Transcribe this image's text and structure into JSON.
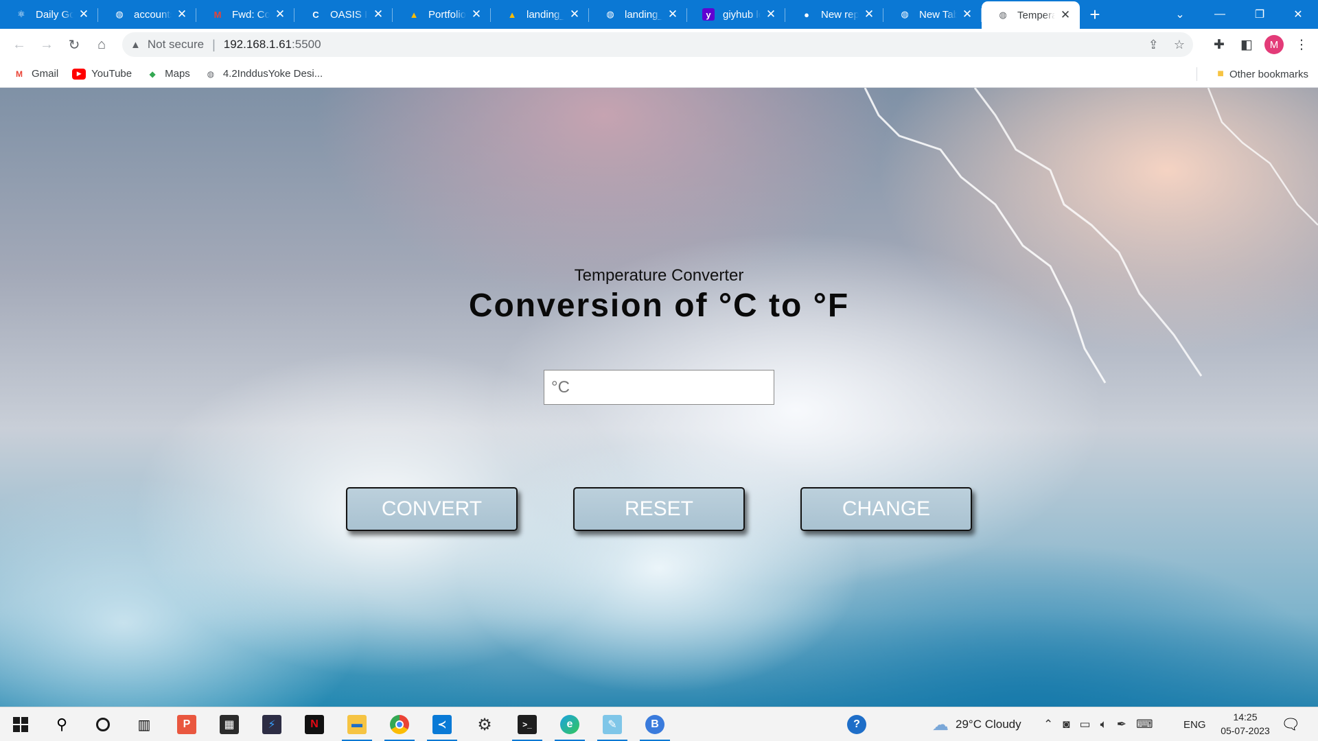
{
  "browser": {
    "tabs": [
      {
        "title": "Daily Goals",
        "icon": "react-icon",
        "icon_color": "#ffffff"
      },
      {
        "title": "accounts.",
        "icon": "globe-icon",
        "icon_color": "#cfd8e3"
      },
      {
        "title": "Fwd: Con",
        "icon": "gmail-icon",
        "icon_color": "#ea4335"
      },
      {
        "title": "OASIS INF",
        "icon": "oasis-icon",
        "icon_color": "#ffffff"
      },
      {
        "title": "Portfolio_",
        "icon": "drive-icon",
        "icon_color": "#fbbc04"
      },
      {
        "title": "landing_c",
        "icon": "drive-icon",
        "icon_color": "#fbbc04"
      },
      {
        "title": "landing_c",
        "icon": "globe-icon",
        "icon_color": "#9aa0a6"
      },
      {
        "title": "giyhub lo",
        "icon": "yahoo-icon",
        "icon_color": "#6001d2"
      },
      {
        "title": "New repo",
        "icon": "github-icon",
        "icon_color": "#ffffff"
      },
      {
        "title": "New Tab",
        "icon": "globe-icon",
        "icon_color": "#9aa0a6"
      },
      {
        "title": "Temperat",
        "icon": "globe-icon",
        "icon_color": "#5f6368",
        "active": true
      }
    ],
    "address": {
      "security_label": "Not secure",
      "host": "192.168.1.61",
      "port": ":5500"
    },
    "profile_initial": "M",
    "bookmarks": [
      {
        "label": "Gmail",
        "icon": "gmail-icon"
      },
      {
        "label": "YouTube",
        "icon": "youtube-icon"
      },
      {
        "label": "Maps",
        "icon": "maps-icon"
      },
      {
        "label": "4.2InddusYoke Desi...",
        "icon": "globe-icon"
      }
    ],
    "other_bookmarks": "Other bookmarks"
  },
  "page": {
    "subtitle": "Temperature Converter",
    "heading": "Conversion of °C to °F",
    "input_placeholder": "°C",
    "input_value": "",
    "buttons": {
      "convert": "CONVERT",
      "reset": "RESET",
      "change": "CHANGE"
    }
  },
  "taskbar": {
    "weather": "29°C  Cloudy",
    "language": "ENG",
    "time": "14:25",
    "date": "05-07-2023",
    "apps": [
      "start-icon",
      "search-icon",
      "cortana-icon",
      "task-view-icon",
      "powerpoint-icon",
      "store-icon",
      "visual-studio-icon",
      "netflix-icon",
      "file-explorer-icon",
      "chrome-icon",
      "vscode-icon",
      "settings-icon",
      "terminal-icon",
      "edge-icon",
      "notepad-icon",
      "app-icon"
    ]
  },
  "colors": {
    "tabbar": "#0b78d4",
    "button_fill": "#b3c9d6",
    "button_text": "#ffffff",
    "heading_text": "#0a0a0a"
  }
}
